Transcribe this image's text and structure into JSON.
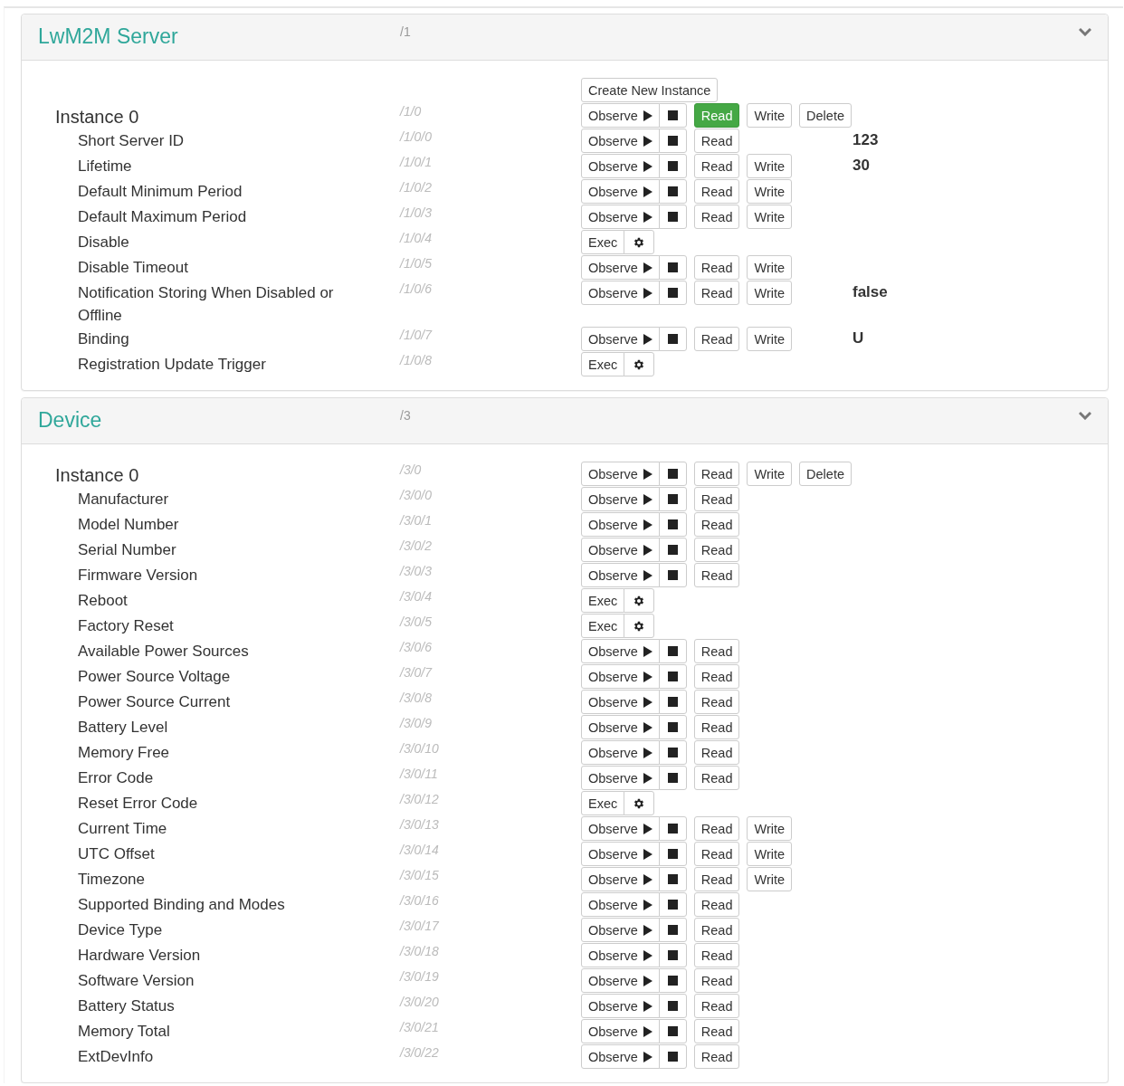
{
  "panels": [
    {
      "title": "LwM2M Server",
      "path": "/1",
      "expanded": true,
      "create_button": "Create New Instance",
      "rows": [
        {
          "kind": "instance",
          "name": "Instance 0",
          "path": "/1/0",
          "buttons": [
            {
              "kind": "observe",
              "label": "Observe"
            },
            {
              "kind": "read",
              "label": "Read",
              "active": true
            },
            {
              "kind": "write",
              "label": "Write"
            },
            {
              "kind": "delete",
              "label": "Delete"
            }
          ]
        },
        {
          "kind": "resource",
          "name": "Short Server ID",
          "path": "/1/0/0",
          "buttons": [
            {
              "kind": "observe",
              "label": "Observe"
            },
            {
              "kind": "read",
              "label": "Read",
              "active": false
            }
          ],
          "value": "123"
        },
        {
          "kind": "resource",
          "name": "Lifetime",
          "path": "/1/0/1",
          "buttons": [
            {
              "kind": "observe",
              "label": "Observe"
            },
            {
              "kind": "read",
              "label": "Read",
              "active": false
            },
            {
              "kind": "write",
              "label": "Write"
            }
          ],
          "value": "30"
        },
        {
          "kind": "resource",
          "name": "Default Minimum Period",
          "path": "/1/0/2",
          "buttons": [
            {
              "kind": "observe",
              "label": "Observe"
            },
            {
              "kind": "read",
              "label": "Read",
              "active": false
            },
            {
              "kind": "write",
              "label": "Write"
            }
          ]
        },
        {
          "kind": "resource",
          "name": "Default Maximum Period",
          "path": "/1/0/3",
          "buttons": [
            {
              "kind": "observe",
              "label": "Observe"
            },
            {
              "kind": "read",
              "label": "Read",
              "active": false
            },
            {
              "kind": "write",
              "label": "Write"
            }
          ]
        },
        {
          "kind": "resource",
          "name": "Disable",
          "path": "/1/0/4",
          "buttons": [
            {
              "kind": "exec",
              "label": "Exec"
            }
          ]
        },
        {
          "kind": "resource",
          "name": "Disable Timeout",
          "path": "/1/0/5",
          "buttons": [
            {
              "kind": "observe",
              "label": "Observe"
            },
            {
              "kind": "read",
              "label": "Read",
              "active": false
            },
            {
              "kind": "write",
              "label": "Write"
            }
          ]
        },
        {
          "kind": "resource",
          "name": "Notification Storing When Disabled or Offline",
          "path": "/1/0/6",
          "buttons": [
            {
              "kind": "observe",
              "label": "Observe"
            },
            {
              "kind": "read",
              "label": "Read",
              "active": false
            },
            {
              "kind": "write",
              "label": "Write"
            }
          ],
          "value": "false"
        },
        {
          "kind": "resource",
          "name": "Binding",
          "path": "/1/0/7",
          "buttons": [
            {
              "kind": "observe",
              "label": "Observe"
            },
            {
              "kind": "read",
              "label": "Read",
              "active": false
            },
            {
              "kind": "write",
              "label": "Write"
            }
          ],
          "value": "U"
        },
        {
          "kind": "resource",
          "name": "Registration Update Trigger",
          "path": "/1/0/8",
          "buttons": [
            {
              "kind": "exec",
              "label": "Exec"
            }
          ]
        }
      ]
    },
    {
      "title": "Device",
      "path": "/3",
      "expanded": true,
      "rows": [
        {
          "kind": "instance",
          "name": "Instance 0",
          "path": "/3/0",
          "buttons": [
            {
              "kind": "observe",
              "label": "Observe"
            },
            {
              "kind": "read",
              "label": "Read",
              "active": false
            },
            {
              "kind": "write",
              "label": "Write"
            },
            {
              "kind": "delete",
              "label": "Delete"
            }
          ]
        },
        {
          "kind": "resource",
          "name": "Manufacturer",
          "path": "/3/0/0",
          "buttons": [
            {
              "kind": "observe",
              "label": "Observe"
            },
            {
              "kind": "read",
              "label": "Read",
              "active": false
            }
          ]
        },
        {
          "kind": "resource",
          "name": "Model Number",
          "path": "/3/0/1",
          "buttons": [
            {
              "kind": "observe",
              "label": "Observe"
            },
            {
              "kind": "read",
              "label": "Read",
              "active": false
            }
          ]
        },
        {
          "kind": "resource",
          "name": "Serial Number",
          "path": "/3/0/2",
          "buttons": [
            {
              "kind": "observe",
              "label": "Observe"
            },
            {
              "kind": "read",
              "label": "Read",
              "active": false
            }
          ]
        },
        {
          "kind": "resource",
          "name": "Firmware Version",
          "path": "/3/0/3",
          "buttons": [
            {
              "kind": "observe",
              "label": "Observe"
            },
            {
              "kind": "read",
              "label": "Read",
              "active": false
            }
          ]
        },
        {
          "kind": "resource",
          "name": "Reboot",
          "path": "/3/0/4",
          "buttons": [
            {
              "kind": "exec",
              "label": "Exec"
            }
          ]
        },
        {
          "kind": "resource",
          "name": "Factory Reset",
          "path": "/3/0/5",
          "buttons": [
            {
              "kind": "exec",
              "label": "Exec"
            }
          ]
        },
        {
          "kind": "resource",
          "name": "Available Power Sources",
          "path": "/3/0/6",
          "buttons": [
            {
              "kind": "observe",
              "label": "Observe"
            },
            {
              "kind": "read",
              "label": "Read",
              "active": false
            }
          ]
        },
        {
          "kind": "resource",
          "name": "Power Source Voltage",
          "path": "/3/0/7",
          "buttons": [
            {
              "kind": "observe",
              "label": "Observe"
            },
            {
              "kind": "read",
              "label": "Read",
              "active": false
            }
          ]
        },
        {
          "kind": "resource",
          "name": "Power Source Current",
          "path": "/3/0/8",
          "buttons": [
            {
              "kind": "observe",
              "label": "Observe"
            },
            {
              "kind": "read",
              "label": "Read",
              "active": false
            }
          ]
        },
        {
          "kind": "resource",
          "name": "Battery Level",
          "path": "/3/0/9",
          "buttons": [
            {
              "kind": "observe",
              "label": "Observe"
            },
            {
              "kind": "read",
              "label": "Read",
              "active": false
            }
          ]
        },
        {
          "kind": "resource",
          "name": "Memory Free",
          "path": "/3/0/10",
          "buttons": [
            {
              "kind": "observe",
              "label": "Observe"
            },
            {
              "kind": "read",
              "label": "Read",
              "active": false
            }
          ]
        },
        {
          "kind": "resource",
          "name": "Error Code",
          "path": "/3/0/11",
          "buttons": [
            {
              "kind": "observe",
              "label": "Observe"
            },
            {
              "kind": "read",
              "label": "Read",
              "active": false
            }
          ]
        },
        {
          "kind": "resource",
          "name": "Reset Error Code",
          "path": "/3/0/12",
          "buttons": [
            {
              "kind": "exec",
              "label": "Exec"
            }
          ]
        },
        {
          "kind": "resource",
          "name": "Current Time",
          "path": "/3/0/13",
          "buttons": [
            {
              "kind": "observe",
              "label": "Observe"
            },
            {
              "kind": "read",
              "label": "Read",
              "active": false
            },
            {
              "kind": "write",
              "label": "Write"
            }
          ]
        },
        {
          "kind": "resource",
          "name": "UTC Offset",
          "path": "/3/0/14",
          "buttons": [
            {
              "kind": "observe",
              "label": "Observe"
            },
            {
              "kind": "read",
              "label": "Read",
              "active": false
            },
            {
              "kind": "write",
              "label": "Write"
            }
          ]
        },
        {
          "kind": "resource",
          "name": "Timezone",
          "path": "/3/0/15",
          "buttons": [
            {
              "kind": "observe",
              "label": "Observe"
            },
            {
              "kind": "read",
              "label": "Read",
              "active": false
            },
            {
              "kind": "write",
              "label": "Write"
            }
          ]
        },
        {
          "kind": "resource",
          "name": "Supported Binding and Modes",
          "path": "/3/0/16",
          "buttons": [
            {
              "kind": "observe",
              "label": "Observe"
            },
            {
              "kind": "read",
              "label": "Read",
              "active": false
            }
          ]
        },
        {
          "kind": "resource",
          "name": "Device Type",
          "path": "/3/0/17",
          "buttons": [
            {
              "kind": "observe",
              "label": "Observe"
            },
            {
              "kind": "read",
              "label": "Read",
              "active": false
            }
          ]
        },
        {
          "kind": "resource",
          "name": "Hardware Version",
          "path": "/3/0/18",
          "buttons": [
            {
              "kind": "observe",
              "label": "Observe"
            },
            {
              "kind": "read",
              "label": "Read",
              "active": false
            }
          ]
        },
        {
          "kind": "resource",
          "name": "Software Version",
          "path": "/3/0/19",
          "buttons": [
            {
              "kind": "observe",
              "label": "Observe"
            },
            {
              "kind": "read",
              "label": "Read",
              "active": false
            }
          ]
        },
        {
          "kind": "resource",
          "name": "Battery Status",
          "path": "/3/0/20",
          "buttons": [
            {
              "kind": "observe",
              "label": "Observe"
            },
            {
              "kind": "read",
              "label": "Read",
              "active": false
            }
          ]
        },
        {
          "kind": "resource",
          "name": "Memory Total",
          "path": "/3/0/21",
          "buttons": [
            {
              "kind": "observe",
              "label": "Observe"
            },
            {
              "kind": "read",
              "label": "Read",
              "active": false
            }
          ]
        },
        {
          "kind": "resource",
          "name": "ExtDevInfo",
          "path": "/3/0/22",
          "buttons": [
            {
              "kind": "observe",
              "label": "Observe"
            },
            {
              "kind": "read",
              "label": "Read",
              "active": false
            }
          ]
        }
      ]
    }
  ]
}
